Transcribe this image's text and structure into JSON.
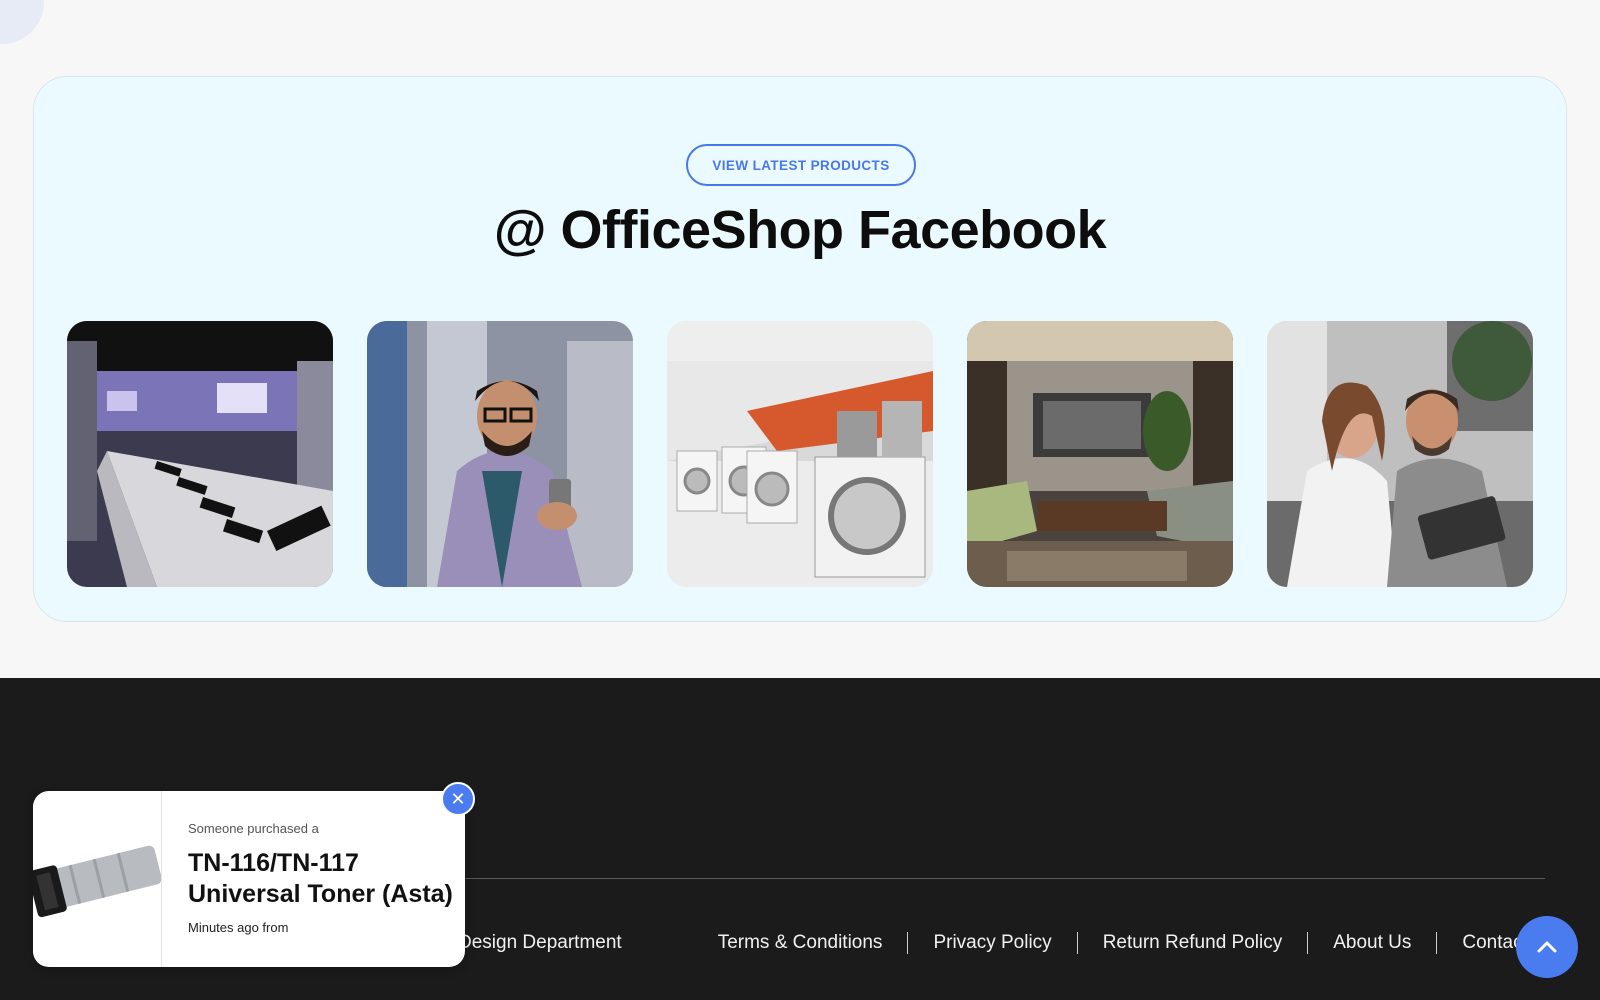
{
  "facebook_section": {
    "button_label": "VIEW LATEST PRODUCTS",
    "title": "@ OfficeShop Facebook",
    "gallery": [
      {
        "name": "gallery-tile-phone-store"
      },
      {
        "name": "gallery-tile-man-with-phone"
      },
      {
        "name": "gallery-tile-appliance-store"
      },
      {
        "name": "gallery-tile-living-room-tv"
      },
      {
        "name": "gallery-tile-couple-with-tablet"
      }
    ]
  },
  "footer": {
    "design_link": "Design Department",
    "links": [
      "Terms & Conditions",
      "Privacy Policy",
      "Return Refund Policy",
      "About Us",
      "Contact"
    ]
  },
  "purchase_popup": {
    "kicker": "Someone purchased a",
    "product": "TN-116/TN-117 Universal Toner (Asta)",
    "time": "Minutes ago from",
    "close_icon": "close-icon"
  },
  "scroll_top": {
    "icon": "chevron-up-icon"
  },
  "colors": {
    "accent": "#4a7cf0",
    "section_bg": "#ebfafe",
    "footer_bg": "#1c1b1c",
    "page_bg": "#f7f7f7"
  }
}
